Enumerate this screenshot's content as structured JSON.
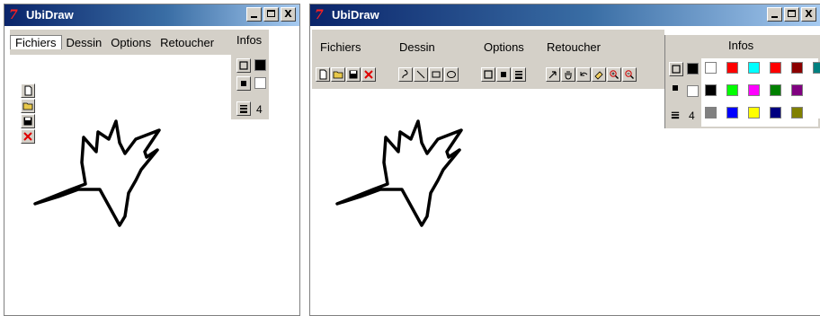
{
  "app": {
    "logo_text": "7",
    "title": "UbiDraw"
  },
  "window_controls": {
    "minimize": "_",
    "maximize": "□",
    "close": "X"
  },
  "menu": {
    "items": [
      "Fichiers",
      "Dessin",
      "Options",
      "Retoucher"
    ]
  },
  "infos": {
    "label": "Infos",
    "brush_size": "4",
    "foreground_color": "#000000",
    "background_color": "#ffffff"
  },
  "left_tools": [
    "new-file-icon",
    "open-folder-icon",
    "save-disk-icon",
    "close-x-icon"
  ],
  "right_tools": {
    "file": [
      "new-file-icon",
      "open-folder-icon",
      "save-disk-icon",
      "close-x-icon"
    ],
    "draw": [
      "freehand-icon",
      "line-icon",
      "rectangle-icon",
      "ellipse-icon"
    ],
    "options": [
      "outline-icon",
      "filled-icon",
      "line-width-icon"
    ],
    "retouch": [
      "select-arrow-icon",
      "hand-icon",
      "undo-icon",
      "eraser-icon",
      "zoom-in-icon",
      "zoom-out-icon"
    ]
  },
  "palette": {
    "colors": [
      "#ffffff",
      "#ff0000",
      "#00ffff",
      "#ff0000",
      "#8b0000",
      "#008080",
      "#000000",
      "#00ff00",
      "#ff00ff",
      "#008000",
      "#800080",
      "#808080",
      "#0000ff",
      "#ffff00",
      "#000080",
      "#808000"
    ]
  },
  "colors": {
    "titlebar_start": "#0a246a",
    "titlebar_end": "#a6caf0",
    "chrome": "#d4d0c8"
  }
}
